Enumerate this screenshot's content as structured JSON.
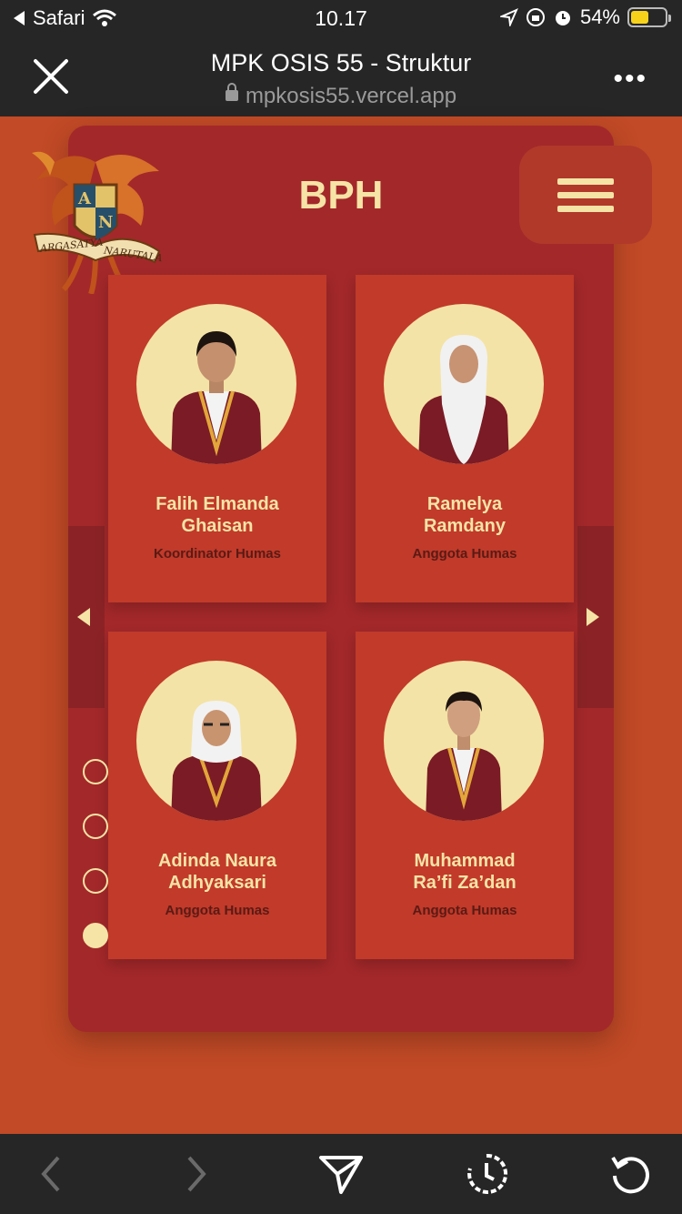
{
  "status_bar": {
    "back_app": "Safari",
    "time": "10.17",
    "battery": "54%"
  },
  "browser": {
    "title": "MPK OSIS 55 - Struktur",
    "url": "mpkosis55.vercel.app",
    "more": "•••"
  },
  "logo": {
    "text_left": "ARGASATYA",
    "text_right": "NARUTALA"
  },
  "section": {
    "title": "BPH"
  },
  "members": [
    {
      "name_line1": "Falih Elmanda",
      "name_line2": "Ghaisan",
      "role": "Koordinator Humas"
    },
    {
      "name_line1": "Ramelya",
      "name_line2": "Ramdany",
      "role": "Anggota Humas"
    },
    {
      "name_line1": "Adinda Naura",
      "name_line2": "Adhyaksari",
      "role": "Anggota Humas"
    },
    {
      "name_line1": "Muhammad",
      "name_line2": "Ra’fi Za’dan",
      "role": "Anggota Humas"
    }
  ],
  "pagination": {
    "total": 4,
    "active_index": 3
  },
  "colors": {
    "accent": "#f6e4a6",
    "page_bg": "#c24a26",
    "panel_bg": "#a3282a",
    "card_bg": "#c13a2a",
    "role_text": "#5a1a14"
  }
}
